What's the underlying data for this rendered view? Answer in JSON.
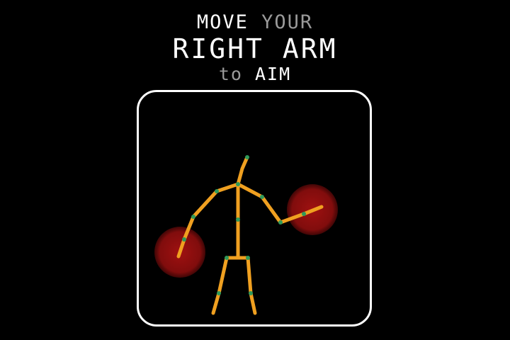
{
  "instruction": {
    "line1": {
      "word1": "MOVE",
      "word2": "YOUR"
    },
    "line2": {
      "text": "RIGHT ARM"
    },
    "line3": {
      "word1": "to",
      "word2": "AIM"
    }
  },
  "colors": {
    "background": "#000000",
    "text_primary": "#ffffff",
    "text_secondary": "#9a9a9a",
    "panel_border": "#ffffff",
    "skeleton_bone": "#f0a020",
    "skeleton_joint": "#2f9a5a",
    "target_zone": "#a01010"
  },
  "icons": {
    "figure": "stick-figure-skeleton-icon",
    "targets": "red-circle-target-icon"
  }
}
